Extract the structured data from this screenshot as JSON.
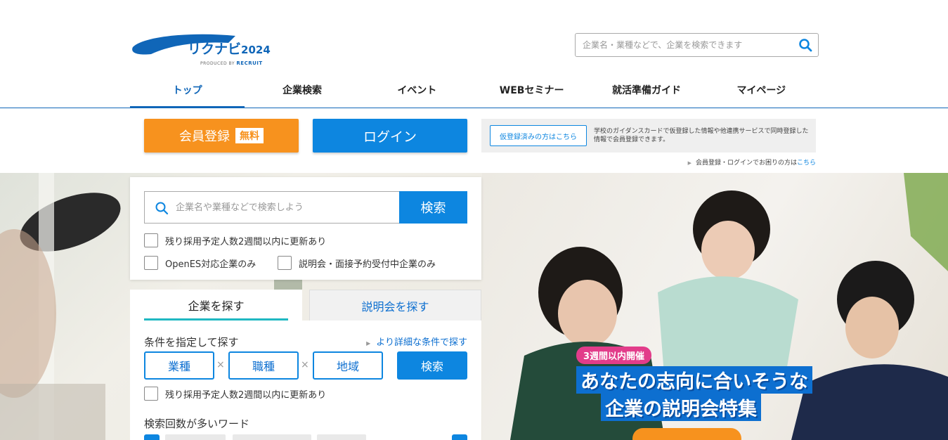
{
  "logo": {
    "name": "リクナビ",
    "year": "2024",
    "produced_by": "PRODUCED BY",
    "recruit": "RECRUIT"
  },
  "header": {
    "search_placeholder": "企業名・業種などで、企業を検索できます"
  },
  "nav": {
    "items": [
      {
        "label": "トップ",
        "active": true
      },
      {
        "label": "企業検索"
      },
      {
        "label": "イベント"
      },
      {
        "label": "WEBセミナー"
      },
      {
        "label": "就活準備ガイド"
      },
      {
        "label": "マイページ"
      }
    ]
  },
  "member": {
    "register_label": "会員登録",
    "free_label": "無料",
    "login_label": "ログイン",
    "pre_reg_button": "仮登録済みの方はこちら",
    "pre_reg_text": "学校のガイダンスカードで仮登録した情報や他連携サービスで同時登録した情報で会員登録できます。",
    "trouble_text": "会員登録・ログインでお困りの方は",
    "trouble_link": "こちら"
  },
  "search": {
    "placeholder": "企業名や業種などで検索しよう",
    "button": "検索",
    "options": [
      "残り採用予定人数2週間以内に更新あり",
      "OpenES対応企業のみ",
      "説明会・面接予約受付中企業のみ"
    ]
  },
  "tabs": {
    "company": "企業を探す",
    "seminar": "説明会を探す"
  },
  "conditions": {
    "title": "条件を指定して探す",
    "more": "より詳細な条件で探す",
    "industry": "業種",
    "job_type": "職種",
    "region": "地域",
    "times": "×",
    "search": "検索",
    "update_option": "残り採用予定人数2週間以内に更新あり",
    "popular_title": "検索回数が多いワード"
  },
  "hero": {
    "badge": "3週間以内開催",
    "headline_1": "あなたの志向に合いそうな",
    "headline_2": "企業の説明会特集"
  },
  "colors": {
    "brand_blue": "#0d86e0",
    "nav_blue": "#1066b8",
    "orange": "#f7921e",
    "pink": "#e23c8a",
    "teal": "#1fb8c2"
  }
}
